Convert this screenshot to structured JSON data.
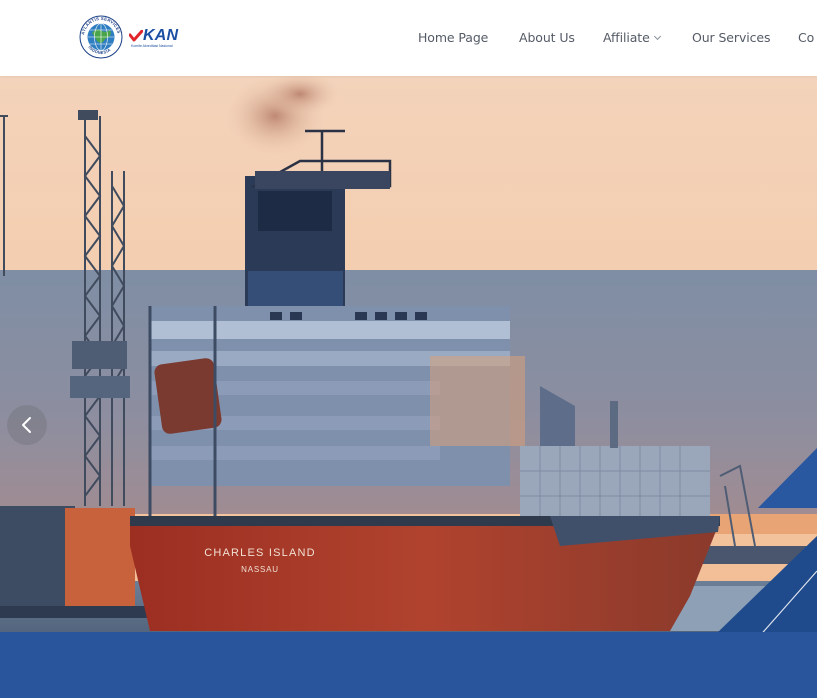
{
  "header": {
    "logos": {
      "ais_ring_text": "ATLANTIS SERVICES · INDONESIA",
      "kan_name": "KAN",
      "kan_subtitle": "Komite Akreditasi Nasional"
    },
    "nav": [
      {
        "label": "Home Page"
      },
      {
        "label": "About Us"
      },
      {
        "label": "Affiliate",
        "has_dropdown": true
      },
      {
        "label": "Our Services"
      },
      {
        "label": "Co"
      }
    ]
  },
  "hero": {
    "ship_name": "CHARLES ISLAND",
    "ship_port": "NASSAU",
    "prev_icon": "chevron-left-icon"
  },
  "colors": {
    "brand_blue": "#28559b",
    "kan_red": "#e0262a",
    "kan_blue": "#1b4fa3",
    "nav_text": "#555b66"
  }
}
